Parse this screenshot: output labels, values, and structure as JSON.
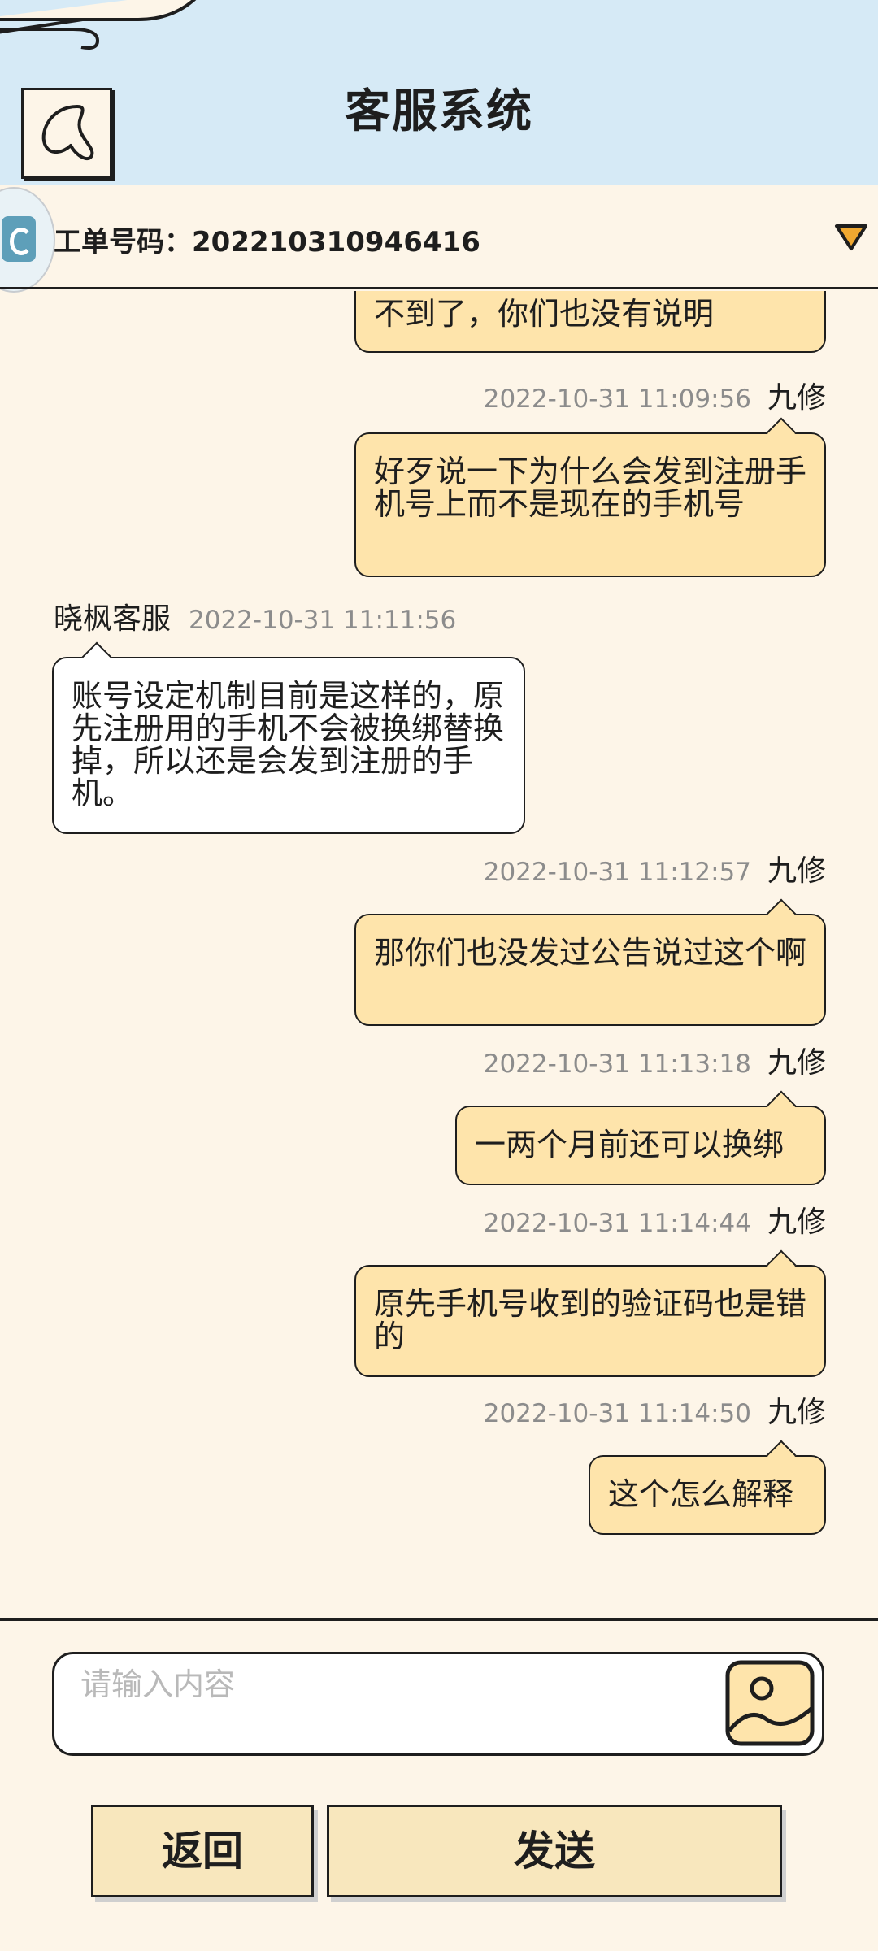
{
  "header": {
    "title": "客服系统",
    "back_icon": "chevron-left-heart-icon"
  },
  "ticket": {
    "label": "工单号码：202210310946416",
    "logo_icon": "app-logo-icon",
    "toggle_icon": "triangle-down-icon",
    "accent": "#f0a830"
  },
  "messages": [
    {
      "from": "me",
      "text": "不到了，你们也没有说明"
    },
    {
      "from": "me",
      "time": "2022-10-31 11:09:56",
      "sender": "九修",
      "text": "好歹说一下为什么会发到注册手机号上而不是现在的手机号"
    },
    {
      "from": "cs",
      "time": "2022-10-31 11:11:56",
      "sender": "晓枫客服",
      "text": "账号设定机制目前是这样的，原先注册用的手机不会被换绑替换掉，所以还是会发到注册的手机。"
    },
    {
      "from": "me",
      "time": "2022-10-31 11:12:57",
      "sender": "九修",
      "text": "那你们也没发过公告说过这个啊"
    },
    {
      "from": "me",
      "time": "2022-10-31 11:13:18",
      "sender": "九修",
      "text": "一两个月前还可以换绑"
    },
    {
      "from": "me",
      "time": "2022-10-31 11:14:44",
      "sender": "九修",
      "text": "原先手机号收到的验证码也是错的"
    },
    {
      "from": "me",
      "time": "2022-10-31 11:14:50",
      "sender": "九修",
      "text": "这个怎么解释"
    }
  ],
  "composer": {
    "placeholder": "请输入内容",
    "value": "",
    "image_icon": "image-picker-icon"
  },
  "buttons": {
    "back_label": "返回",
    "send_label": "发送"
  },
  "colors": {
    "header_bg": "#d6eaf6",
    "page_bg": "#fdf5e8",
    "my_bubble": "#fee4ab",
    "cs_bubble": "#ffffff",
    "button_bg": "#f8e7bd"
  }
}
